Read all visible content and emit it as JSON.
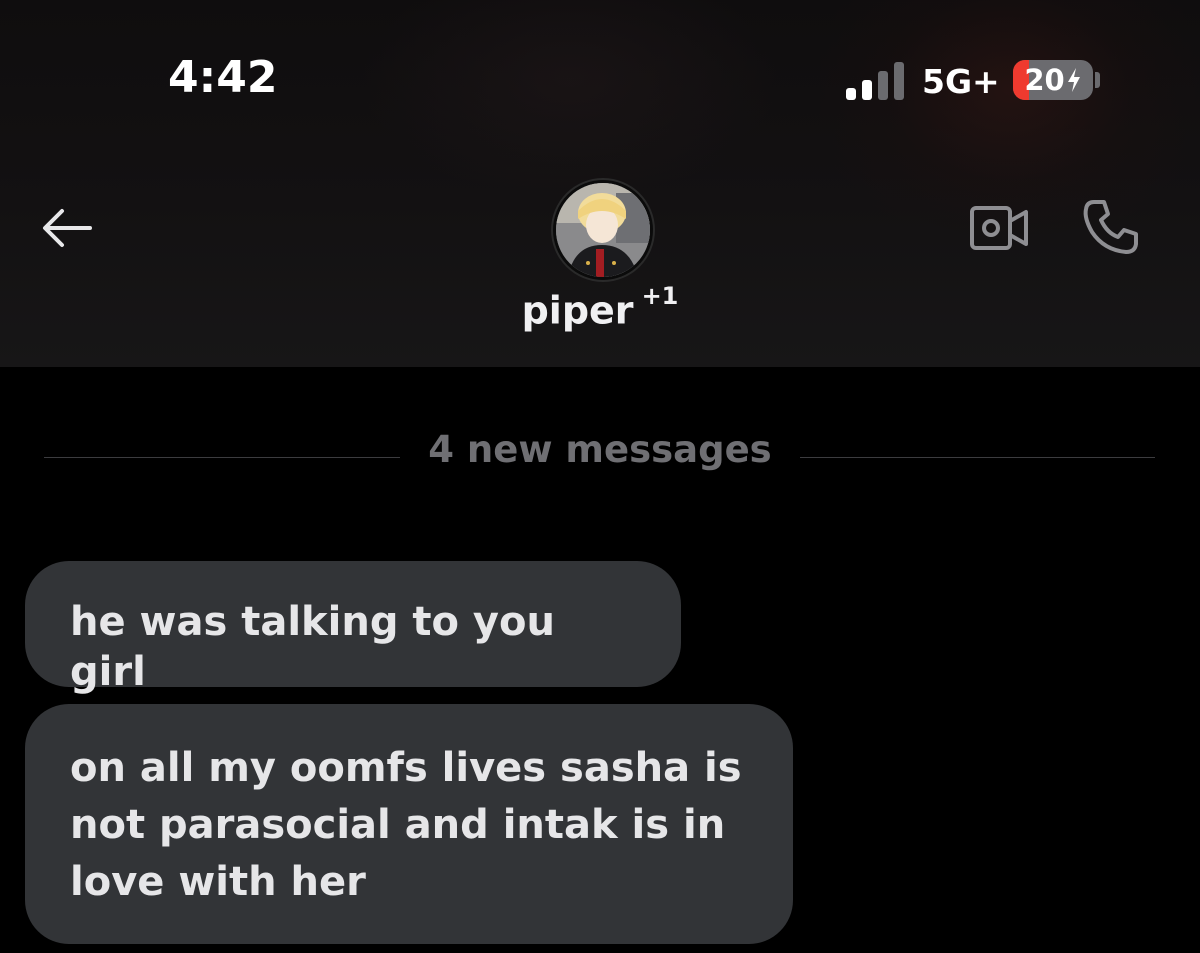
{
  "status_bar": {
    "time": "4:42",
    "network": "5G+",
    "battery_level": "20",
    "battery_fraction": 0.2,
    "signal_bars_active": 2,
    "signal_bars_total": 4,
    "colors": {
      "battery_low": "#ef3a2f",
      "bar_active": "#ffffff",
      "bar_inactive": "#6b6b6f"
    }
  },
  "header": {
    "contact_name": "piper",
    "extra_participants": "+1",
    "icons": {
      "back": "back-arrow-icon",
      "video": "video-camera-icon",
      "call": "phone-icon"
    }
  },
  "divider": {
    "label": "4 new messages"
  },
  "messages": [
    {
      "text": "he was talking to you girl"
    },
    {
      "text": "on all my oomfs lives sasha is not parasocial and intak is in love with her"
    }
  ],
  "colors": {
    "background": "#000000",
    "bubble": "#323437",
    "bubble_text": "#e6e6e8",
    "divider_text": "#6f6f73"
  }
}
